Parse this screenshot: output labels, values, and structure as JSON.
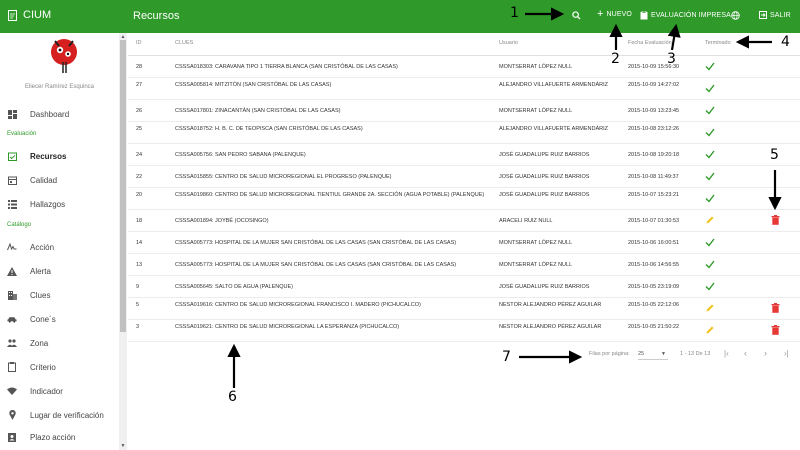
{
  "app": {
    "name": "CIUM",
    "page_title": "Recursos",
    "header_color": "#2f9a2a",
    "toolbar": {
      "search_icon": "search-icon",
      "new_label": "NUEVO",
      "print_label": "EVALUACIÓN IMPRESA",
      "language_icon": "globe-icon",
      "logout_label": "SALIR"
    }
  },
  "sidebar": {
    "user_name": "Eliecer Ramírez Esquinca",
    "sections": {
      "evaluacion": "Evaluación",
      "catalogo": "Catálogo"
    },
    "items": [
      {
        "label": "Dashboard",
        "icon": "dashboard-icon"
      },
      {
        "label": "Recursos",
        "icon": "calendar-check-icon",
        "active": true
      },
      {
        "label": "Calidad",
        "icon": "calendar-icon"
      },
      {
        "label": "Hallazgos",
        "icon": "list-icon"
      },
      {
        "label": "Acción",
        "icon": "signature-icon"
      },
      {
        "label": "Alerta",
        "icon": "warning-icon"
      },
      {
        "label": "Clues",
        "icon": "building-icon"
      },
      {
        "label": "Cone´s",
        "icon": "car-icon"
      },
      {
        "label": "Zona",
        "icon": "people-icon"
      },
      {
        "label": "Criterio",
        "icon": "clipboard-icon"
      },
      {
        "label": "Indicador",
        "icon": "wifi-icon"
      },
      {
        "label": "Lugar de verificación",
        "icon": "location-icon"
      },
      {
        "label": "Plazo acción",
        "icon": "contact-icon"
      }
    ]
  },
  "table": {
    "headers": {
      "id": "ID",
      "clues": "CLUES",
      "user": "Usuario",
      "date": "Fecha Evaluación",
      "done": "Terminado"
    },
    "rows": [
      {
        "id": "28",
        "clues": "CSSSA018303: CARAVANA TIPO 1 TIERRA BLANCA (SAN CRISTÓBAL DE LAS CASAS)",
        "user": "MONTSERRAT LÓPEZ NULL",
        "date": "2015-10-09 15:56:30",
        "done": "check",
        "delete": false
      },
      {
        "id": "27",
        "clues": "CSSSA005814: MITZITÓN (SAN CRISTÓBAL DE LAS CASAS)",
        "user": "ALEJANDRO VILLAFUERTE ARMENDÁRIZ",
        "date": "2015-10-09 14:27:02",
        "done": "check",
        "delete": false
      },
      {
        "id": "26",
        "clues": "CSSSA017801: ZINACANTÁN (SAN CRISTÓBAL DE LAS CASAS)",
        "user": "MONTSERRAT LÓPEZ NULL",
        "date": "2015-10-09 13:23:45",
        "done": "check",
        "delete": false
      },
      {
        "id": "25",
        "clues": "CSSSA018752: H. B. C. DE TEOPISCA (SAN CRISTÓBAL DE LAS CASAS)",
        "user": "ALEJANDRO VILLAFUERTE ARMENDÁRIZ",
        "date": "2015-10-08 23:12:26",
        "done": "check",
        "delete": false
      },
      {
        "id": "24",
        "clues": "CSSSA005756: SAN PEDRO SABANA (PALENQUE)",
        "user": "JOSÉ GUADALUPE RUIZ BARRIOS",
        "date": "2015-10-08 19:20:18",
        "done": "check",
        "delete": false
      },
      {
        "id": "22",
        "clues": "CSSSA015855: CENTRO DE SALUD MICROREGIONAL EL PROGRESO (PALENQUE)",
        "user": "JOSÉ GUADALUPE RUIZ BARRIOS",
        "date": "2015-10-08 11:49:37",
        "done": "check",
        "delete": false
      },
      {
        "id": "20",
        "clues": "CSSSA019860: CENTRO DE SALUD MICROREGIONAL TIENTIUL GRANDE 2A. SECCIÓN (AGUA POTABLE) (PALENQUE)",
        "user": "JOSÉ GUADALUPE RUIZ BARRIOS",
        "date": "2015-10-07 15:23:21",
        "done": "check",
        "delete": false
      },
      {
        "id": "18",
        "clues": "CSSSA001894: JOYBÉ (OCOSINGO)",
        "user": "ARACELI RUIZ NULL",
        "date": "2015-10-07 01:30:53",
        "done": "pencil",
        "delete": true
      },
      {
        "id": "14",
        "clues": "CSSSA005773: HOSPITAL DE LA MUJER SAN CRISTÓBAL DE LAS CASAS (SAN CRISTÓBAL DE LAS CASAS)",
        "user": "MONTSERRAT LÓPEZ NULL",
        "date": "2015-10-06 16:00:51",
        "done": "check",
        "delete": false
      },
      {
        "id": "13",
        "clues": "CSSSA005773: HOSPITAL DE LA MUJER SAN CRISTÓBAL DE LAS CASAS (SAN CRISTÓBAL DE LAS CASAS)",
        "user": "MONTSERRAT LÓPEZ NULL",
        "date": "2015-10-06 14:56:55",
        "done": "check",
        "delete": false
      },
      {
        "id": "9",
        "clues": "CSSSA005645: SALTO DE AGUA (PALENQUE)",
        "user": "JOSÉ GUADALUPE RUIZ BARRIOS",
        "date": "2015-10-05 23:19:09",
        "done": "check",
        "delete": false
      },
      {
        "id": "5",
        "clues": "CSSSA019616: CENTRO DE SALUD MICROREGIONAL FRANCISCO I. MADERO (PICHUCALCO)",
        "user": "NESTOR ALEJANDRO PÉREZ AGUILAR",
        "date": "2015-10-05 22:12:06",
        "done": "pencil",
        "delete": true
      },
      {
        "id": "3",
        "clues": "CSSSA019621: CENTRO DE SALUD MICROREGIONAL LA ESPERANZA (PICHUCALCO)",
        "user": "NESTOR ALEJANDRO PÉREZ AGUILAR",
        "date": "2015-10-05 21:50:22",
        "done": "pencil",
        "delete": true
      }
    ]
  },
  "pagination": {
    "rows_per_page_label": "Filas por página:",
    "rows_per_page_value": "25",
    "range_label": "1 - 13 De 13"
  },
  "annotations": [
    "1",
    "2",
    "3",
    "4",
    "5",
    "6",
    "7"
  ],
  "colors": {
    "check": "#2f9a2a",
    "pencil": "#f0c419",
    "delete": "#e53935",
    "section": "#2f9a2a"
  }
}
